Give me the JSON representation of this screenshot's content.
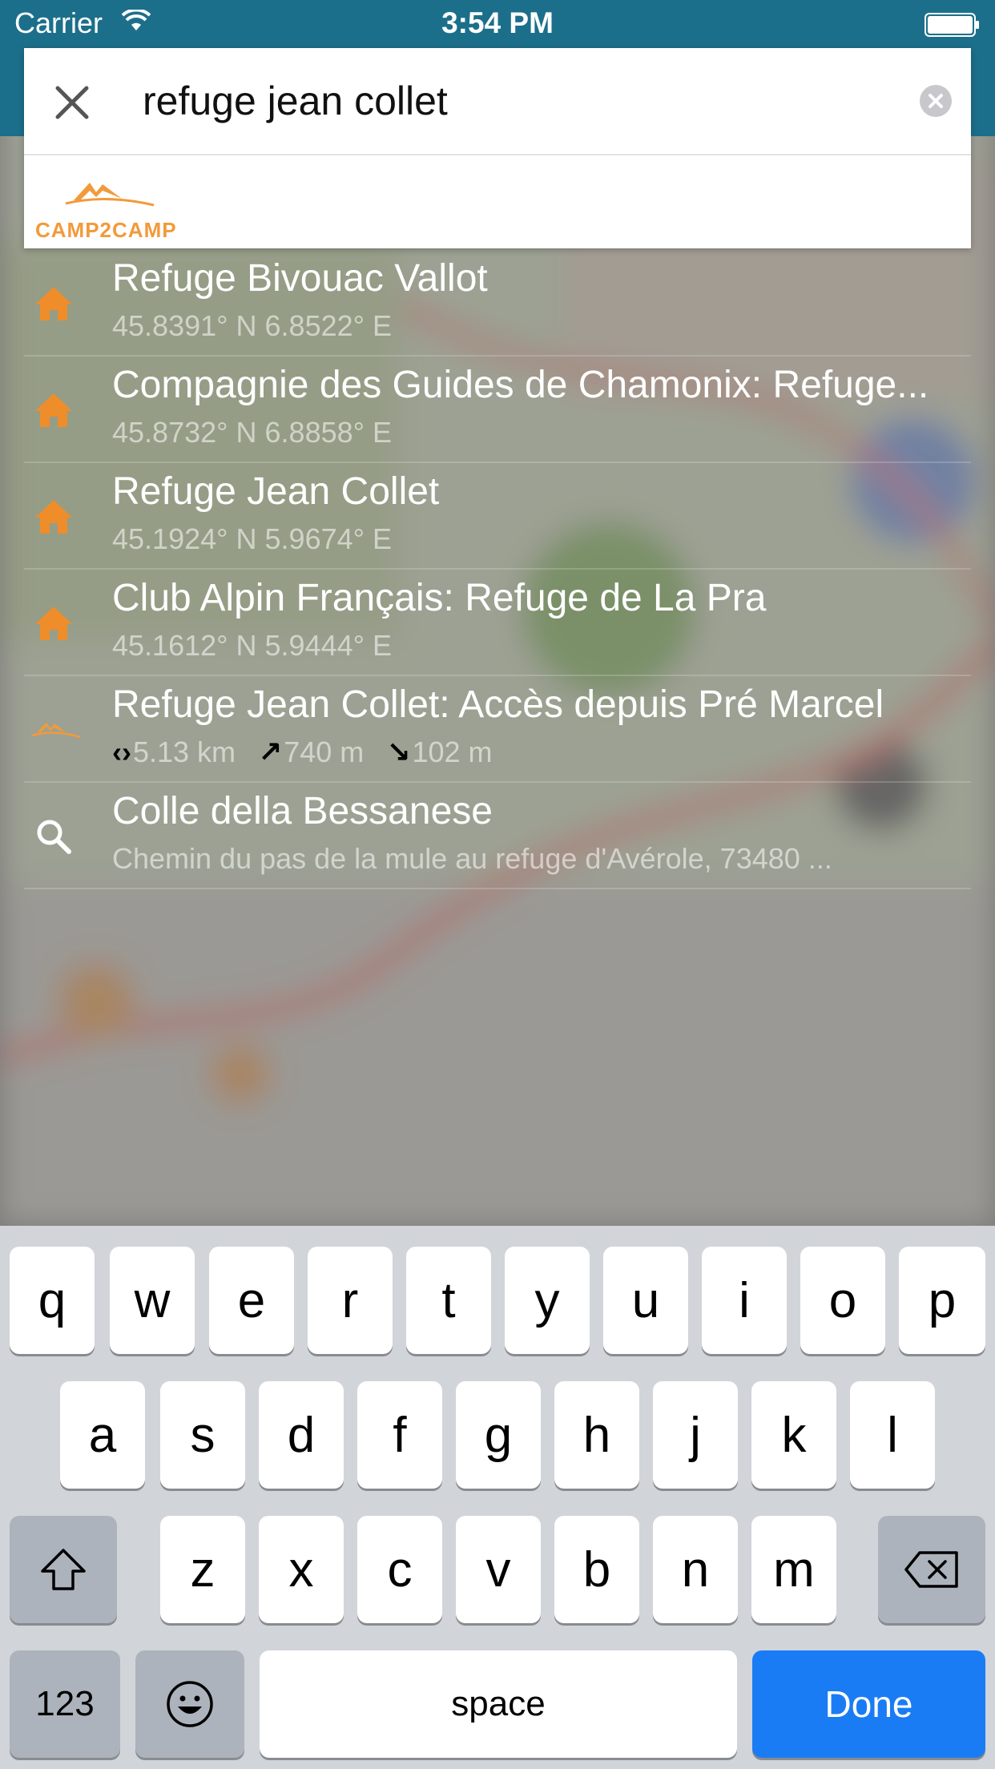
{
  "status_bar": {
    "carrier": "Carrier",
    "time": "3:54 PM"
  },
  "search": {
    "value": "refuge jean collet",
    "close_icon": "close-icon",
    "clear_icon": "clear-icon"
  },
  "provider": {
    "name": "CAMP2CAMP",
    "color": "#f29a3a"
  },
  "results": [
    {
      "type": "hut",
      "icon": "house-icon",
      "title": "Refuge Bivouac Vallot",
      "subtitle": "45.8391° N 6.8522° E"
    },
    {
      "type": "hut",
      "icon": "house-icon",
      "title": "Compagnie des Guides de Chamonix: Refuge...",
      "subtitle": "45.8732° N 6.8858° E"
    },
    {
      "type": "hut",
      "icon": "house-icon",
      "title": "Refuge Jean Collet",
      "subtitle": "45.1924° N 5.9674° E"
    },
    {
      "type": "hut",
      "icon": "house-icon",
      "title": "Club Alpin Français: Refuge de La Pra",
      "subtitle": "45.1612° N 5.9444° E"
    },
    {
      "type": "route",
      "icon": "camp2camp-icon",
      "title": "Refuge Jean Collet: Accès depuis Pré Marcel",
      "stats": {
        "distance": "5.13 km",
        "ascent": "740 m",
        "descent": "102 m"
      }
    },
    {
      "type": "place",
      "icon": "search-icon",
      "title": "Colle della Bessanese",
      "subtitle": "Chemin du pas de la mule au refuge d'Avérole, 73480 ..."
    }
  ],
  "keyboard": {
    "row1": [
      "q",
      "w",
      "e",
      "r",
      "t",
      "y",
      "u",
      "i",
      "o",
      "p"
    ],
    "row2": [
      "a",
      "s",
      "d",
      "f",
      "g",
      "h",
      "j",
      "k",
      "l"
    ],
    "row3": [
      "z",
      "x",
      "c",
      "v",
      "b",
      "n",
      "m"
    ],
    "numbers_label": "123",
    "space_label": "space",
    "done_label": "Done",
    "accent": "#1a7cf5"
  }
}
